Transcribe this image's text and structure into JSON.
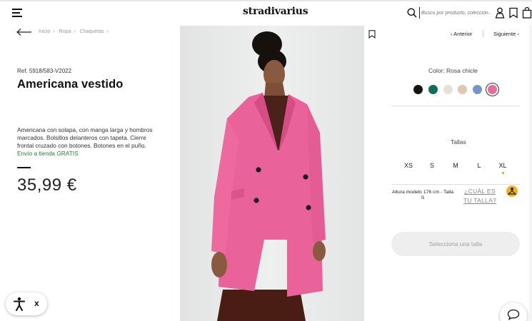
{
  "header": {
    "logo": "stradivarius",
    "search_placeholder": "Busco por producto, colección...",
    "icons": [
      "menu-icon",
      "search-icon",
      "account-icon",
      "wishlist-icon",
      "bag-icon"
    ]
  },
  "breadcrumb": [
    "Inicio",
    "Ropa",
    "Chaquetas"
  ],
  "product": {
    "reference": "Ref. 5918/583-V2022",
    "title": "Americana vestido",
    "description": "Americana con solapa, con manga larga y hombros marcados. Bolsillos delanteros con tapeta. Cierre frontal cruzado con botones. Botones en el puño.",
    "shipping": "Envío a tienda GRATIS",
    "price": "35,99 €"
  },
  "navigation": {
    "previous": "Anterior",
    "next": "Siguiente"
  },
  "colors": {
    "label": "Color: Rosa chicle",
    "swatches": [
      {
        "name": "black",
        "hex": "#141414"
      },
      {
        "name": "green",
        "hex": "#0f6e55"
      },
      {
        "name": "light-beige",
        "hex": "#e6e0d6"
      },
      {
        "name": "beige",
        "hex": "#dcc8b3"
      },
      {
        "name": "blue",
        "hex": "#7594c8"
      },
      {
        "name": "pink",
        "hex": "#ea6b95",
        "selected": true
      }
    ]
  },
  "sizes": {
    "label": "Tallas",
    "options": [
      "XS",
      "S",
      "M",
      "L",
      "XL"
    ],
    "model_info": "Altura modelo 176 cm - Talla S",
    "find_size_link": "¿CUÁL ES TU TALLA?"
  },
  "cta": {
    "select_size": "Selecciona una talla"
  },
  "accessibility": {
    "close": "x"
  }
}
